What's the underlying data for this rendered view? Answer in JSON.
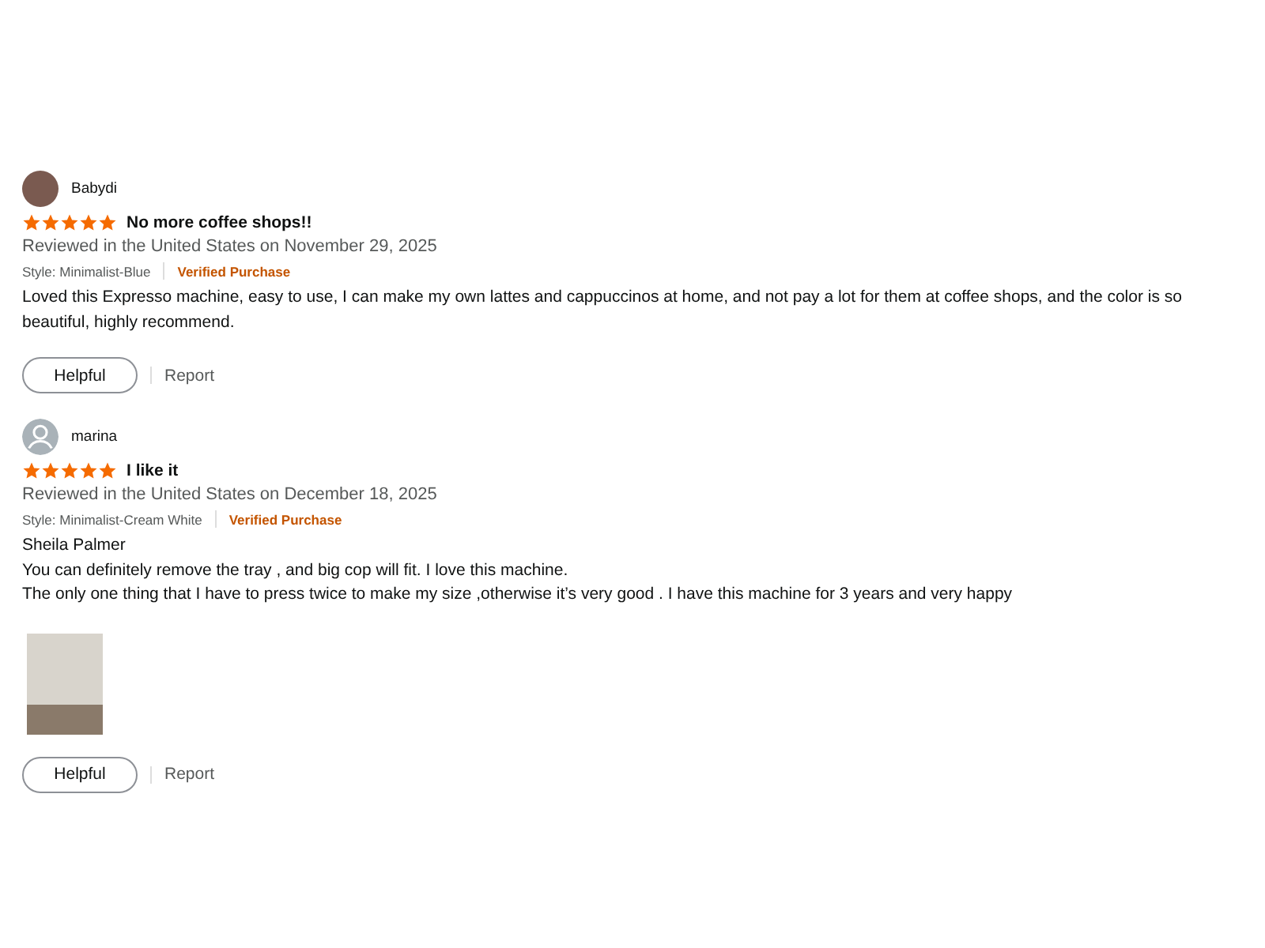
{
  "reviews": [
    {
      "avatar": {
        "kind": "photo"
      },
      "author": "Babydi",
      "stars": 5,
      "title": "No more coffee shops!!",
      "meta": "Reviewed in the United States on November 29, 2025",
      "style": "Style: Minimalist-Blue",
      "verified": "Verified Purchase",
      "body": [
        "Loved this Expresso machine, easy to use, I can make my own lattes and cappuccinos at home, and not pay a lot for them at coffee shops, and the color is so beautiful, highly recommend."
      ],
      "has_photo": false,
      "helpful": "Helpful",
      "report": "Report"
    },
    {
      "avatar": {
        "kind": "silhouette"
      },
      "author": "marina",
      "stars": 5,
      "title": "I like it",
      "meta": "Reviewed in the United States on December 18, 2025",
      "style": "Style: Minimalist-Cream White",
      "verified": "Verified Purchase",
      "body": [
        "Sheila Palmer",
        "You can definitely remove the tray , and big cop will fit. I love this machine.",
        "The only one thing that I have to press twice to make my size ,otherwise it’s very good . I have this machine for 3 years and very happy"
      ],
      "has_photo": true,
      "helpful": "Helpful",
      "report": "Report"
    }
  ]
}
